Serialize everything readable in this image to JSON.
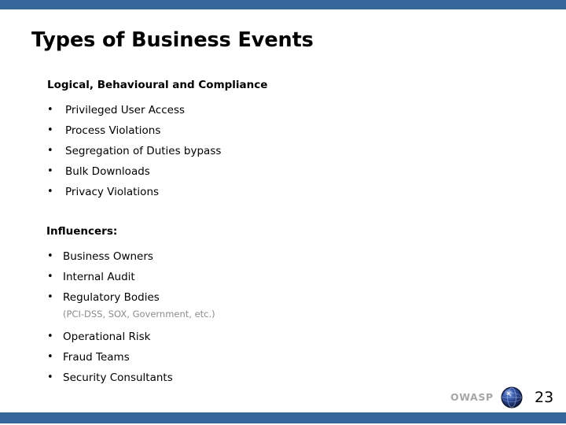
{
  "slide": {
    "title": "Types of Business Events",
    "accent_color": "#36679b",
    "background_color": "#ffffff",
    "sections": [
      {
        "heading": "Logical, Behavioural and Compliance",
        "bullets": [
          {
            "text": "Privileged User Access"
          },
          {
            "text": "Process Violations"
          },
          {
            "text": "Segregation of Duties bypass"
          },
          {
            "text": "Bulk Downloads"
          },
          {
            "text": "Privacy Violations"
          }
        ]
      },
      {
        "heading": "Influencers:",
        "bullets": [
          {
            "text": "Business Owners"
          },
          {
            "text": "Internal Audit"
          },
          {
            "text": "Regulatory Bodies",
            "note": "(PCI-DSS, SOX, Government, etc.)"
          },
          {
            "text": "Operational Risk"
          },
          {
            "text": "Fraud Teams"
          },
          {
            "text": "Security Consultants"
          }
        ]
      }
    ]
  },
  "footer": {
    "brand": "OWASP",
    "brand_color": "#a6a6a6",
    "globe_icon": "owasp-globe-icon",
    "slide_number": "23"
  },
  "bullet_glyph": "•"
}
